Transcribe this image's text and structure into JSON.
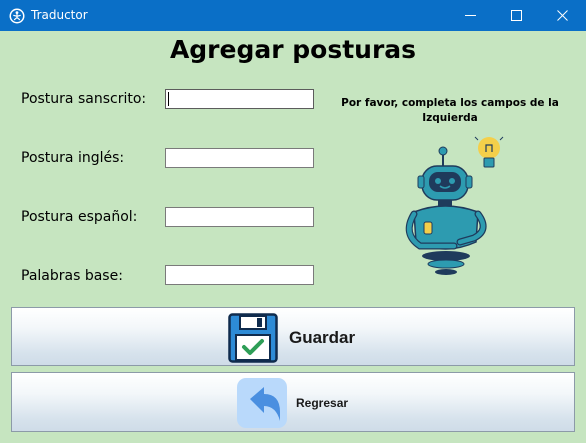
{
  "window": {
    "title": "Traductor",
    "app_icon": "yoga-pose-icon",
    "controls": [
      "minimize-icon",
      "maximize-icon",
      "close-icon"
    ]
  },
  "page": {
    "heading": "Agregar posturas"
  },
  "form": {
    "fields": [
      {
        "label": "Postura sanscrito:",
        "value": "",
        "placeholder": "",
        "focused": true
      },
      {
        "label": "Postura inglés:",
        "value": "",
        "placeholder": ""
      },
      {
        "label": "Postura español:",
        "value": "",
        "placeholder": ""
      },
      {
        "label": "Palabras base:",
        "value": "",
        "placeholder": ""
      }
    ]
  },
  "helper": {
    "message": "Por favor, completa los campos de la Izquierda",
    "illustration": "robot-with-lightbulb-illustration"
  },
  "actions": {
    "save_label": "Guardar",
    "save_icon": "floppy-disk-check-icon",
    "back_label": "Regresar",
    "back_icon": "back-arrow-icon"
  },
  "colors": {
    "titlebar": "#0a6fc7",
    "background": "#c6e5c0",
    "robot_body": "#2d9bb0",
    "robot_dark": "#1f3b5c",
    "lightbulb": "#f4cf4a",
    "save_icon_blue": "#2d8bd6",
    "back_icon_blue": "#4a8fe0"
  }
}
